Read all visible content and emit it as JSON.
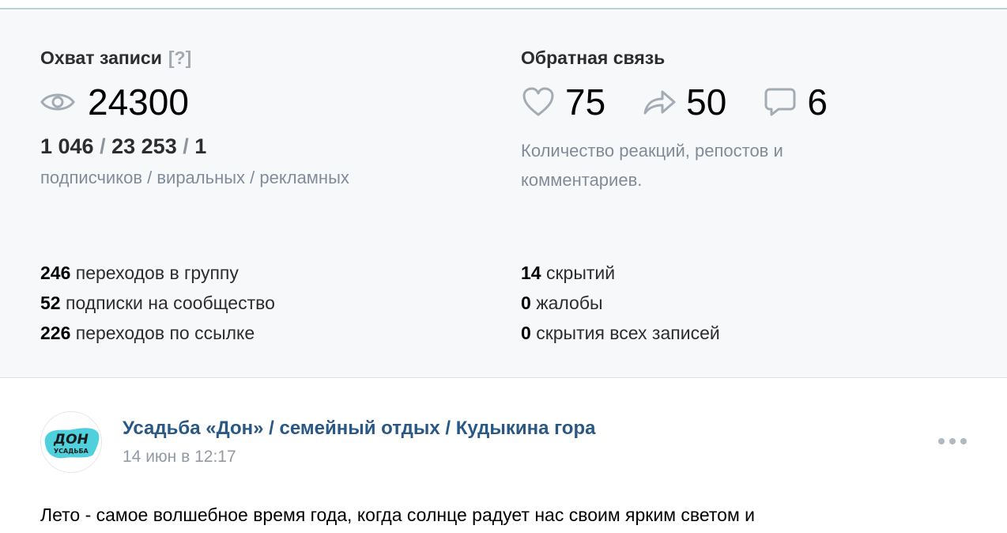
{
  "reach": {
    "title": "Охват записи",
    "hint": "[?]",
    "icon": "eye-icon",
    "total": "24300",
    "split": {
      "subscribers": "1 046",
      "viral": "23 253",
      "ads": "1",
      "separator": "/"
    },
    "split_labels": "подписчиков / виральных / рекламных"
  },
  "feedback": {
    "title": "Обратная связь",
    "likes": {
      "icon": "heart-icon",
      "count": "75"
    },
    "reposts": {
      "icon": "share-arrow-icon",
      "count": "50"
    },
    "comments": {
      "icon": "comment-icon",
      "count": "6"
    },
    "description": "Количество реакций, репостов и комментариев."
  },
  "left_metrics": [
    {
      "value": "246",
      "label": "переходов в группу"
    },
    {
      "value": "52",
      "label": "подписки на сообщество"
    },
    {
      "value": "226",
      "label": "переходов по ссылке"
    }
  ],
  "right_metrics": [
    {
      "value": "14",
      "label": "скрытий"
    },
    {
      "value": "0",
      "label": "жалобы"
    },
    {
      "value": "0",
      "label": "скрытия всех записей"
    }
  ],
  "post": {
    "author": "Усадьба «Дон» / семейный отдых / Кудыкина гора",
    "date": "14 июн в 12:17",
    "avatar_logo_text": "ДОН УСАДЬБА",
    "text": "Лето - самое волшебное время года, когда солнце радует нас своим ярким светом и"
  },
  "colors": {
    "link": "#2a5885",
    "muted": "#818c99",
    "stats_bg": "#f7f8fa",
    "avatar_accent": "#4fd1dd"
  }
}
